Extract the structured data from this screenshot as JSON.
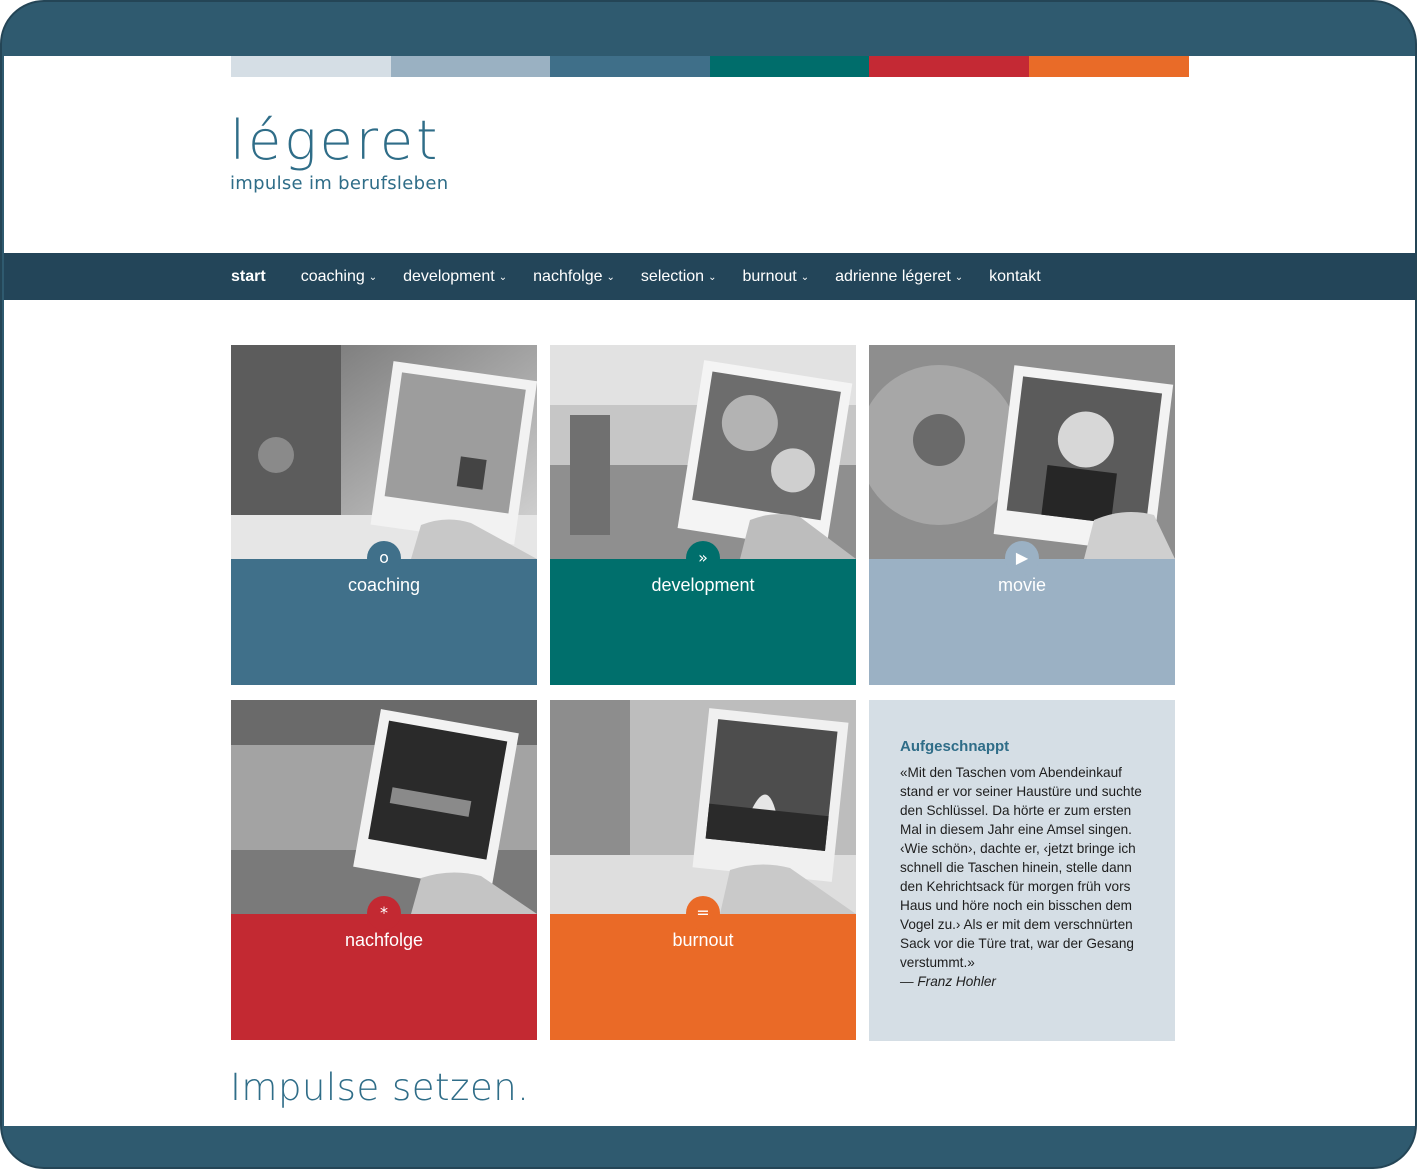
{
  "colors": {
    "frame": "#2f5a6f",
    "nav_bg": "#234559",
    "brand": "#2f6d88",
    "bar": [
      "#d5dee5",
      "#9ab1c2",
      "#3f6f89",
      "#006d6b",
      "#c42934",
      "#e96b28"
    ],
    "tile_coaching": "#40708a",
    "tile_development": "#006f6c",
    "tile_movie": "#9bb1c4",
    "tile_nachfolge": "#c32932",
    "tile_burnout": "#ea6a27"
  },
  "logo": {
    "word": "légeret",
    "tagline": "impulse im berufsleben"
  },
  "nav": {
    "items": [
      {
        "label": "start",
        "active": true,
        "dropdown": false
      },
      {
        "label": "coaching",
        "dropdown": true
      },
      {
        "label": "development",
        "dropdown": true
      },
      {
        "label": "nachfolge",
        "dropdown": true
      },
      {
        "label": "selection",
        "dropdown": true
      },
      {
        "label": "burnout",
        "dropdown": true
      },
      {
        "label": "adrienne légeret",
        "dropdown": true
      },
      {
        "label": "kontakt",
        "dropdown": false
      }
    ]
  },
  "tiles": [
    {
      "label": "coaching",
      "badge": "o",
      "icon": "circle-icon"
    },
    {
      "label": "development",
      "badge": "»",
      "icon": "double-chevron-icon"
    },
    {
      "label": "movie",
      "badge": "▶",
      "icon": "play-icon"
    },
    {
      "label": "nachfolge",
      "badge": "*",
      "icon": "asterisk-icon"
    },
    {
      "label": "burnout",
      "badge": "=",
      "icon": "equals-icon"
    }
  ],
  "quote": {
    "title": "Aufgeschnappt",
    "text": "«Mit den Taschen vom Abendeinkauf stand er vor seiner Haustüre und suchte den Schlüssel. Da hörte er zum ersten Mal in diesem Jahr eine Amsel singen. ‹Wie schön›, dachte er, ‹jetzt bringe ich schnell die Taschen hinein, stelle dann den Kehrichtsack für morgen früh vors Haus und höre noch ein bisschen dem Vogel zu.› Als er mit dem verschnürten Sack vor die Türe trat, war der Gesang verstummt.»",
    "author": "— Franz Hohler"
  },
  "headline": "Impulse setzen."
}
